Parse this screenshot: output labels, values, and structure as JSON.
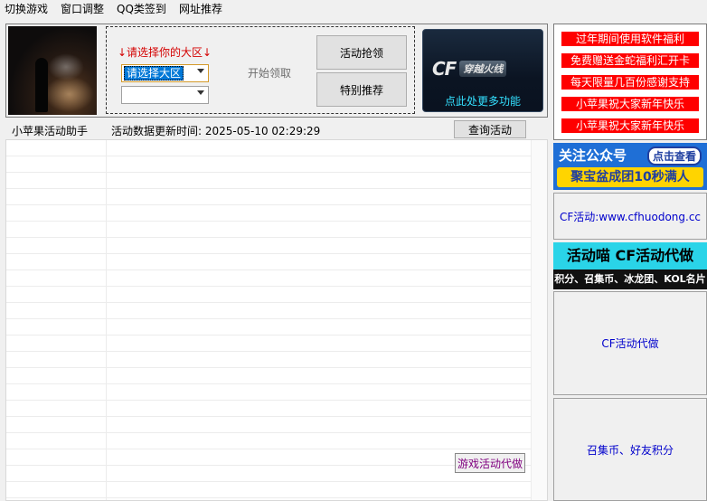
{
  "menu": {
    "items": [
      "切换游戏",
      "窗口调整",
      "QQ类签到",
      "网址推荐"
    ]
  },
  "region": {
    "title": "↓请选择你的大区↓",
    "primary_value": "请选择大区",
    "secondary_value": ""
  },
  "actions": {
    "start_label": "开始领取",
    "grab_label": "活动抢领",
    "special_label": "特别推荐"
  },
  "cf_banner": {
    "logo_cf": "CF",
    "logo_name": "穿越火线",
    "more_label": "点此处更多功能"
  },
  "notices": [
    "过年期间使用软件福利",
    "免费赠送金蛇福利汇开卡",
    "每天限量几百份感谢支持",
    "小苹果祝大家新年快乐",
    "小苹果祝大家新年快乐"
  ],
  "ads": {
    "ad1_line1": "关注公众号",
    "ad1_button": "点击查看",
    "ad1_line2": "聚宝盆成团10秒满人",
    "site_link": "CF活动:www.cfhuodong.cc",
    "ad2_line1": "活动喵 CF活动代做",
    "ad2_line2": "积分、召集币、冰龙团、KOL名片",
    "cf_daizuo": "CF活动代做",
    "zhaoji": "召集币、好友积分"
  },
  "info": {
    "app_name": "小苹果活动助手",
    "update_time": "活动数据更新时间: 2025-05-10 02:29:29",
    "query_label": "查询活动"
  },
  "grid": {
    "game_service_label": "游戏活动代做"
  },
  "colors": {
    "notice_red": "#ff0000",
    "link_blue": "#0000cc",
    "region_red": "#d40000",
    "cf_cyan": "#33e0ff"
  }
}
